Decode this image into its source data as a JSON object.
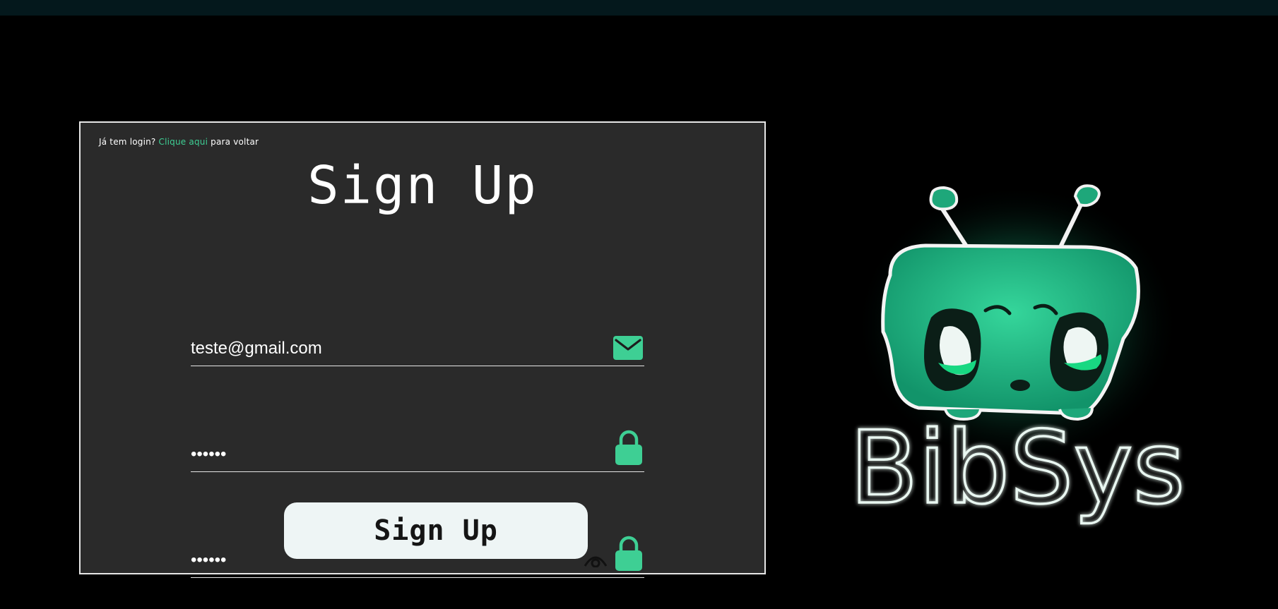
{
  "header": {
    "hint_prefix": "Já tem login?",
    "hint_link": "Clique aqui",
    "hint_suffix": "para voltar",
    "title": "Sign Up"
  },
  "form": {
    "email_value": "teste@gmail.com",
    "password_value": "••••••",
    "confirm_password_value": "••••••",
    "submit_label": "Sign Up"
  },
  "brand": {
    "logo_text": "BibSys"
  },
  "icons": {
    "email": "envelope-icon",
    "password": "lock-icon",
    "confirm_password": "lock-icon",
    "visibility": "eye-icon"
  },
  "colors": {
    "accent": "#3ecf94",
    "panel_bg": "#2a2a2a",
    "page_bg": "#000000",
    "button_bg": "#eef5f5"
  }
}
